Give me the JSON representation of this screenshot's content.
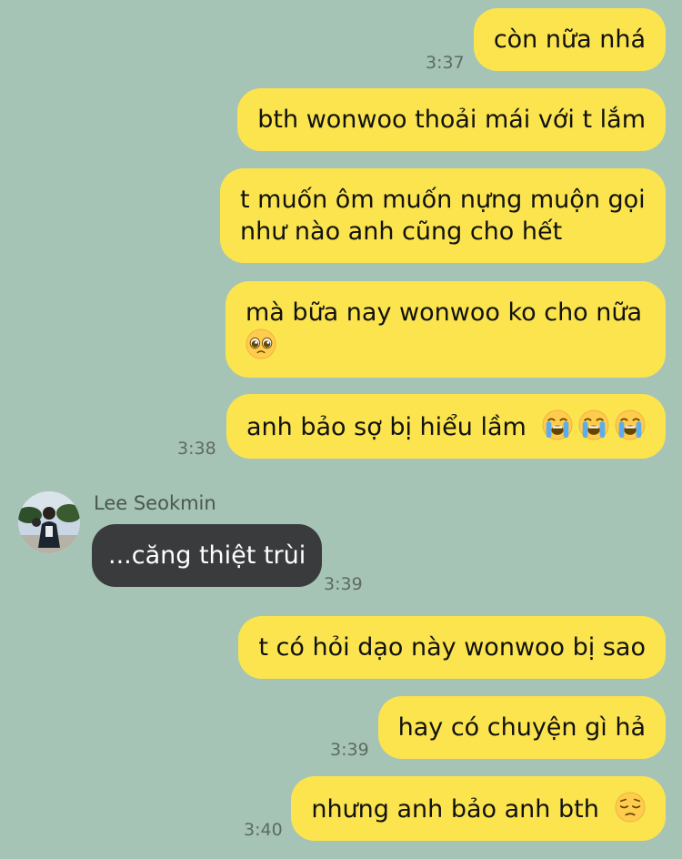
{
  "colors": {
    "background": "#a6c4b6",
    "outgoing_bubble": "#fbe44e",
    "incoming_bubble": "#3a3b3d"
  },
  "messages": [
    {
      "direction": "out",
      "text": "còn nữa nhá",
      "time": "3:37"
    },
    {
      "direction": "out",
      "text": "bth wonwoo thoải mái với t lắm"
    },
    {
      "direction": "out",
      "text": "t muốn ôm muốn nựng muộn gọi như nào anh cũng cho hết"
    },
    {
      "direction": "out",
      "text": "mà bữa nay wonwoo ko cho nữa",
      "emoji": "pleading-face"
    },
    {
      "direction": "out",
      "text": "anh bảo sợ bị hiểu lầm",
      "emoji": "loudly-crying-face x3",
      "time": "3:38"
    },
    {
      "direction": "in",
      "sender": "Lee Seokmin",
      "text": "...căng thiệt trùi",
      "time": "3:39"
    },
    {
      "direction": "out",
      "text": "t có hỏi dạo này wonwoo bị sao"
    },
    {
      "direction": "out",
      "text": "hay có chuyện gì hả",
      "time": "3:39"
    },
    {
      "direction": "out",
      "text": "nhưng anh bảo anh bth",
      "emoji": "pensive-face",
      "time": "3:40"
    }
  ]
}
